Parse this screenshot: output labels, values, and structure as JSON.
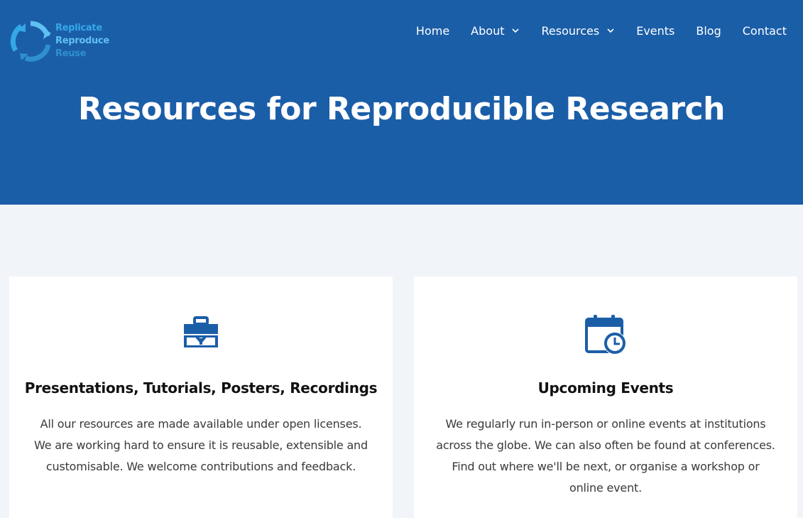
{
  "brand": {
    "line1": "Replicate",
    "line2": "Reproduce",
    "line3": "Reuse",
    "colors": {
      "primary": "#1b5ea8",
      "logo_light": "#5fc0f2",
      "logo_dark": "#2f8fd0"
    },
    "icon": "recycle-arrows-icon"
  },
  "nav": {
    "items": [
      {
        "label": "Home"
      },
      {
        "label": "About",
        "dropdown": true
      },
      {
        "label": "Resources",
        "dropdown": true
      },
      {
        "label": "Events"
      },
      {
        "label": "Blog"
      },
      {
        "label": "Contact"
      }
    ],
    "dropdown_icon": "chevron-down-icon"
  },
  "hero": {
    "title": "Resources for Reproducible Research"
  },
  "cards": [
    {
      "icon": "toolbox-icon",
      "title": "Presentations, Tutorials, Posters, Recordings",
      "text": "All our resources are made available under open licenses. We are working hard to ensure it is reusable, extensible and customisable. We welcome contributions and feedback."
    },
    {
      "icon": "calendar-clock-icon",
      "title": "Upcoming Events",
      "text": "We regularly run in-person or online events at institutions across the globe. We can also often be found at conferences. Find out where we'll be next, or organise a workshop or online event."
    }
  ]
}
